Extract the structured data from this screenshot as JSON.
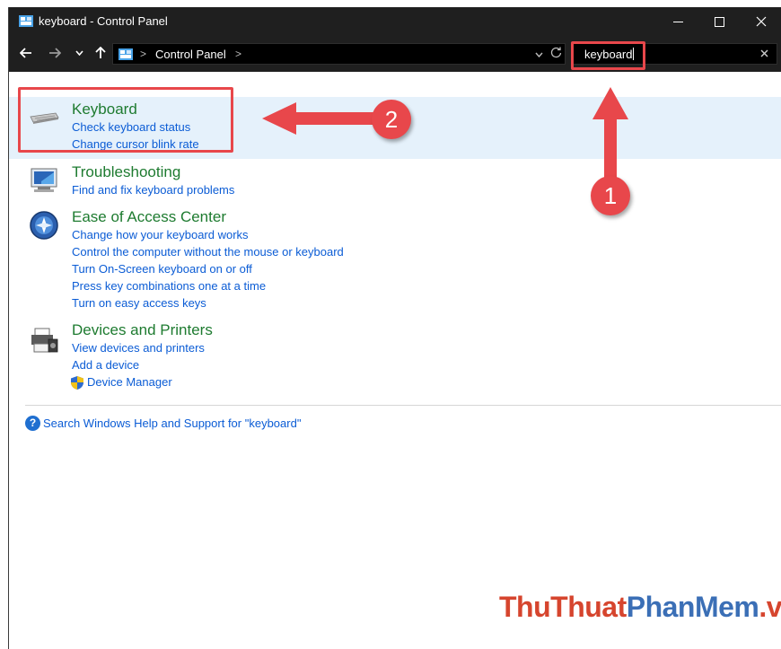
{
  "window": {
    "title": "keyboard - Control Panel",
    "minimize": "–",
    "maximize": "☐",
    "close": "✕"
  },
  "navbar": {
    "back": "←",
    "forward": "→",
    "recent": "⌄",
    "up": "↑",
    "breadcrumb": "Control Panel",
    "separator": ">",
    "dropdown": "⌄",
    "refresh": "↻"
  },
  "search": {
    "value": "keyboard",
    "clear": "✕"
  },
  "results": [
    {
      "title": "Keyboard",
      "icon": "keyboard-icon",
      "links": [
        "Check keyboard status",
        "Change cursor blink rate"
      ]
    },
    {
      "title": "Troubleshooting",
      "icon": "troubleshooting-icon",
      "links": [
        "Find and fix keyboard problems"
      ]
    },
    {
      "title": "Ease of Access Center",
      "icon": "ease-of-access-icon",
      "links": [
        "Change how your keyboard works",
        "Control the computer without the mouse or keyboard",
        "Turn On-Screen keyboard on or off",
        "Press key combinations one at a time",
        "Turn on easy access keys"
      ]
    },
    {
      "title": "Devices and Printers",
      "icon": "printer-icon",
      "links": [
        "View devices and printers",
        "Add a device",
        "Device Manager"
      ]
    }
  ],
  "help": {
    "icon": "?",
    "text": "Search Windows Help and Support for \"keyboard\""
  },
  "annotations": {
    "step1": "1",
    "step2": "2",
    "color": "#e8474b"
  },
  "watermark": {
    "part1": "ThuThuat",
    "part2": "PhanMem",
    "part3": ".vn"
  }
}
